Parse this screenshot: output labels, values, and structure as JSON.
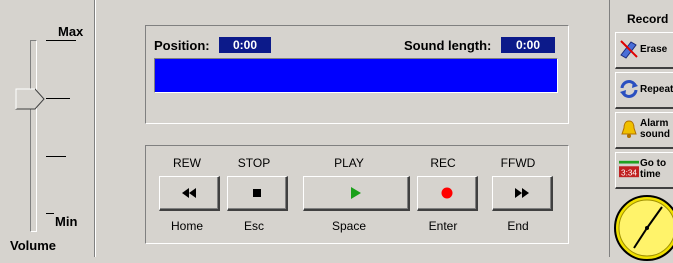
{
  "volume": {
    "max_label": "Max",
    "min_label": "Min",
    "title": "Volume",
    "level": 0.7
  },
  "position": {
    "position_label": "Position:",
    "position_value": "0:00",
    "sound_length_label": "Sound length:",
    "sound_length_value": "0:00"
  },
  "transport": {
    "buttons": [
      {
        "label": "REW",
        "shortcut": "Home",
        "icon": "rewind-icon"
      },
      {
        "label": "STOP",
        "shortcut": "Esc",
        "icon": "stop-icon"
      },
      {
        "label": "PLAY",
        "shortcut": "Space",
        "icon": "play-icon"
      },
      {
        "label": "REC",
        "shortcut": "Enter",
        "icon": "record-dot-icon"
      },
      {
        "label": "FFWD",
        "shortcut": "End",
        "icon": "fast-forward-icon"
      }
    ]
  },
  "record_panel": {
    "title": "Record",
    "erase_label": "Erase",
    "repeat_label": "Repeat",
    "alarm_label_1": "Alarm",
    "alarm_label_2": "sound",
    "goto_label_1": "Go to",
    "goto_label_2": "time",
    "goto_icon_time": "3:34"
  },
  "colors": {
    "progress": "#0000ff",
    "timebox": "#0c1a8a",
    "play": "#1aa01a",
    "rec": "#ff0000"
  }
}
